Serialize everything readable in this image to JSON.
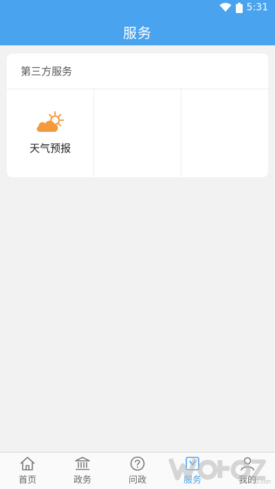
{
  "status_bar": {
    "time": "5:31"
  },
  "header": {
    "title": "服务"
  },
  "section": {
    "title": "第三方服务",
    "items": [
      {
        "label": "天气预报",
        "icon": "weather-partly-cloudy-icon"
      },
      {
        "label": ""
      },
      {
        "label": ""
      }
    ]
  },
  "tabbar": {
    "tabs": [
      {
        "label": "首页",
        "icon": "home-icon"
      },
      {
        "label": "政务",
        "icon": "building-icon"
      },
      {
        "label": "问政",
        "icon": "question-icon"
      },
      {
        "label": "服务",
        "icon": "service-icon",
        "active": true
      },
      {
        "label": "我的",
        "icon": "user-icon"
      }
    ]
  },
  "colors": {
    "primary": "#4aa3ef",
    "weather_cloud": "#f39a3c",
    "watermark_text": "k73.com"
  }
}
